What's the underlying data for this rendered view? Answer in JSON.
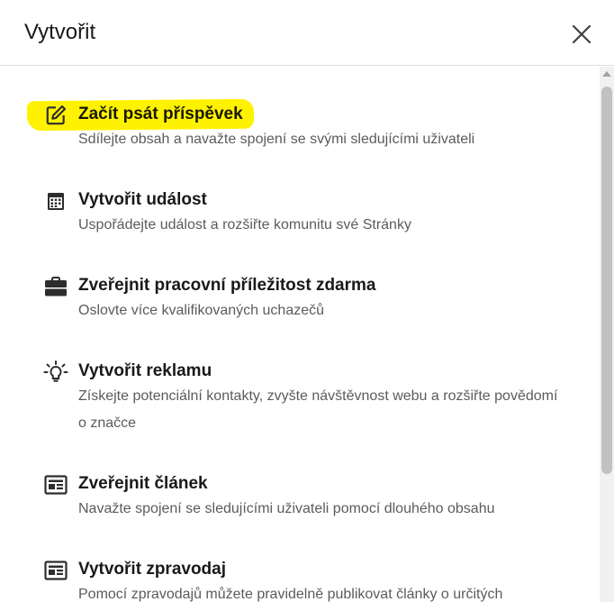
{
  "header": {
    "title": "Vytvořit",
    "close_icon": "close-icon"
  },
  "colors": {
    "highlight": "#fff200",
    "divider": "#e0dfdc",
    "title_text": "#1a1a1a",
    "desc_text": "#595959"
  },
  "items": [
    {
      "icon": "edit-icon",
      "title": "Začít psát příspěvek",
      "desc": "Sdílejte obsah a navažte spojení se svými sledujícími uživateli",
      "highlighted": true
    },
    {
      "icon": "calendar-icon",
      "title": "Vytvořit událost",
      "desc": "Uspořádejte událost a rozšiřte komunitu své Stránky"
    },
    {
      "icon": "briefcase-icon",
      "title": "Zveřejnit pracovní příležitost zdarma",
      "desc": "Oslovte více kvalifikovaných uchazečů"
    },
    {
      "icon": "lightbulb-icon",
      "title": "Vytvořit reklamu",
      "desc": "Získejte potenciální kontakty, zvyšte návštěvnost webu a rozšiřte povědomí o značce"
    },
    {
      "icon": "article-icon",
      "title": "Zveřejnit článek",
      "desc": "Navažte spojení se sledujícími uživateli pomocí dlouhého obsahu"
    },
    {
      "icon": "newsletter-icon",
      "title": "Vytvořit zpravodaj",
      "desc": "Pomocí zpravodajů můžete pravidelně publikovat články o určitých"
    }
  ]
}
